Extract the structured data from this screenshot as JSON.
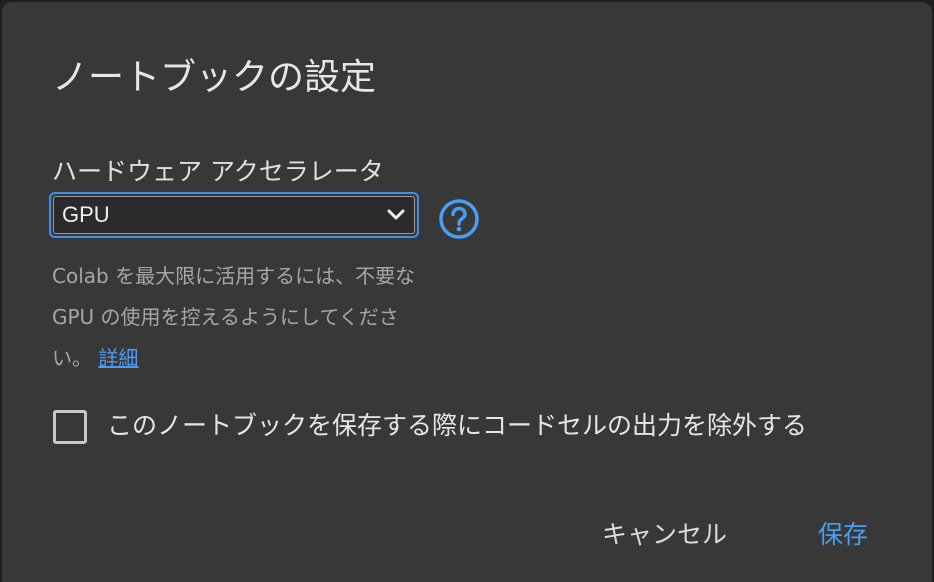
{
  "dialog": {
    "title": "ノートブックの設定",
    "accelerator": {
      "label": "ハードウェア アクセラレータ",
      "selected": "GPU",
      "help_icon": "help-circle-icon",
      "dropdown_icon": "chevron-down-icon"
    },
    "help_text": {
      "line1": "Colab を最大限に活用するには、不要な",
      "line2": "GPU の使用を控えるようにしてくださ",
      "line3_prefix": "い。",
      "link_label": "詳細"
    },
    "omit_output": {
      "label": "このノートブックを保存する際にコードセルの出力を除外する",
      "checked": false
    },
    "buttons": {
      "cancel_label": "キャンセル",
      "save_label": "保存"
    },
    "colors": {
      "background": "#383838",
      "accent": "#4a9cf5",
      "focus_ring": "#3b8ff0",
      "muted_text": "#a6a6a6"
    }
  }
}
